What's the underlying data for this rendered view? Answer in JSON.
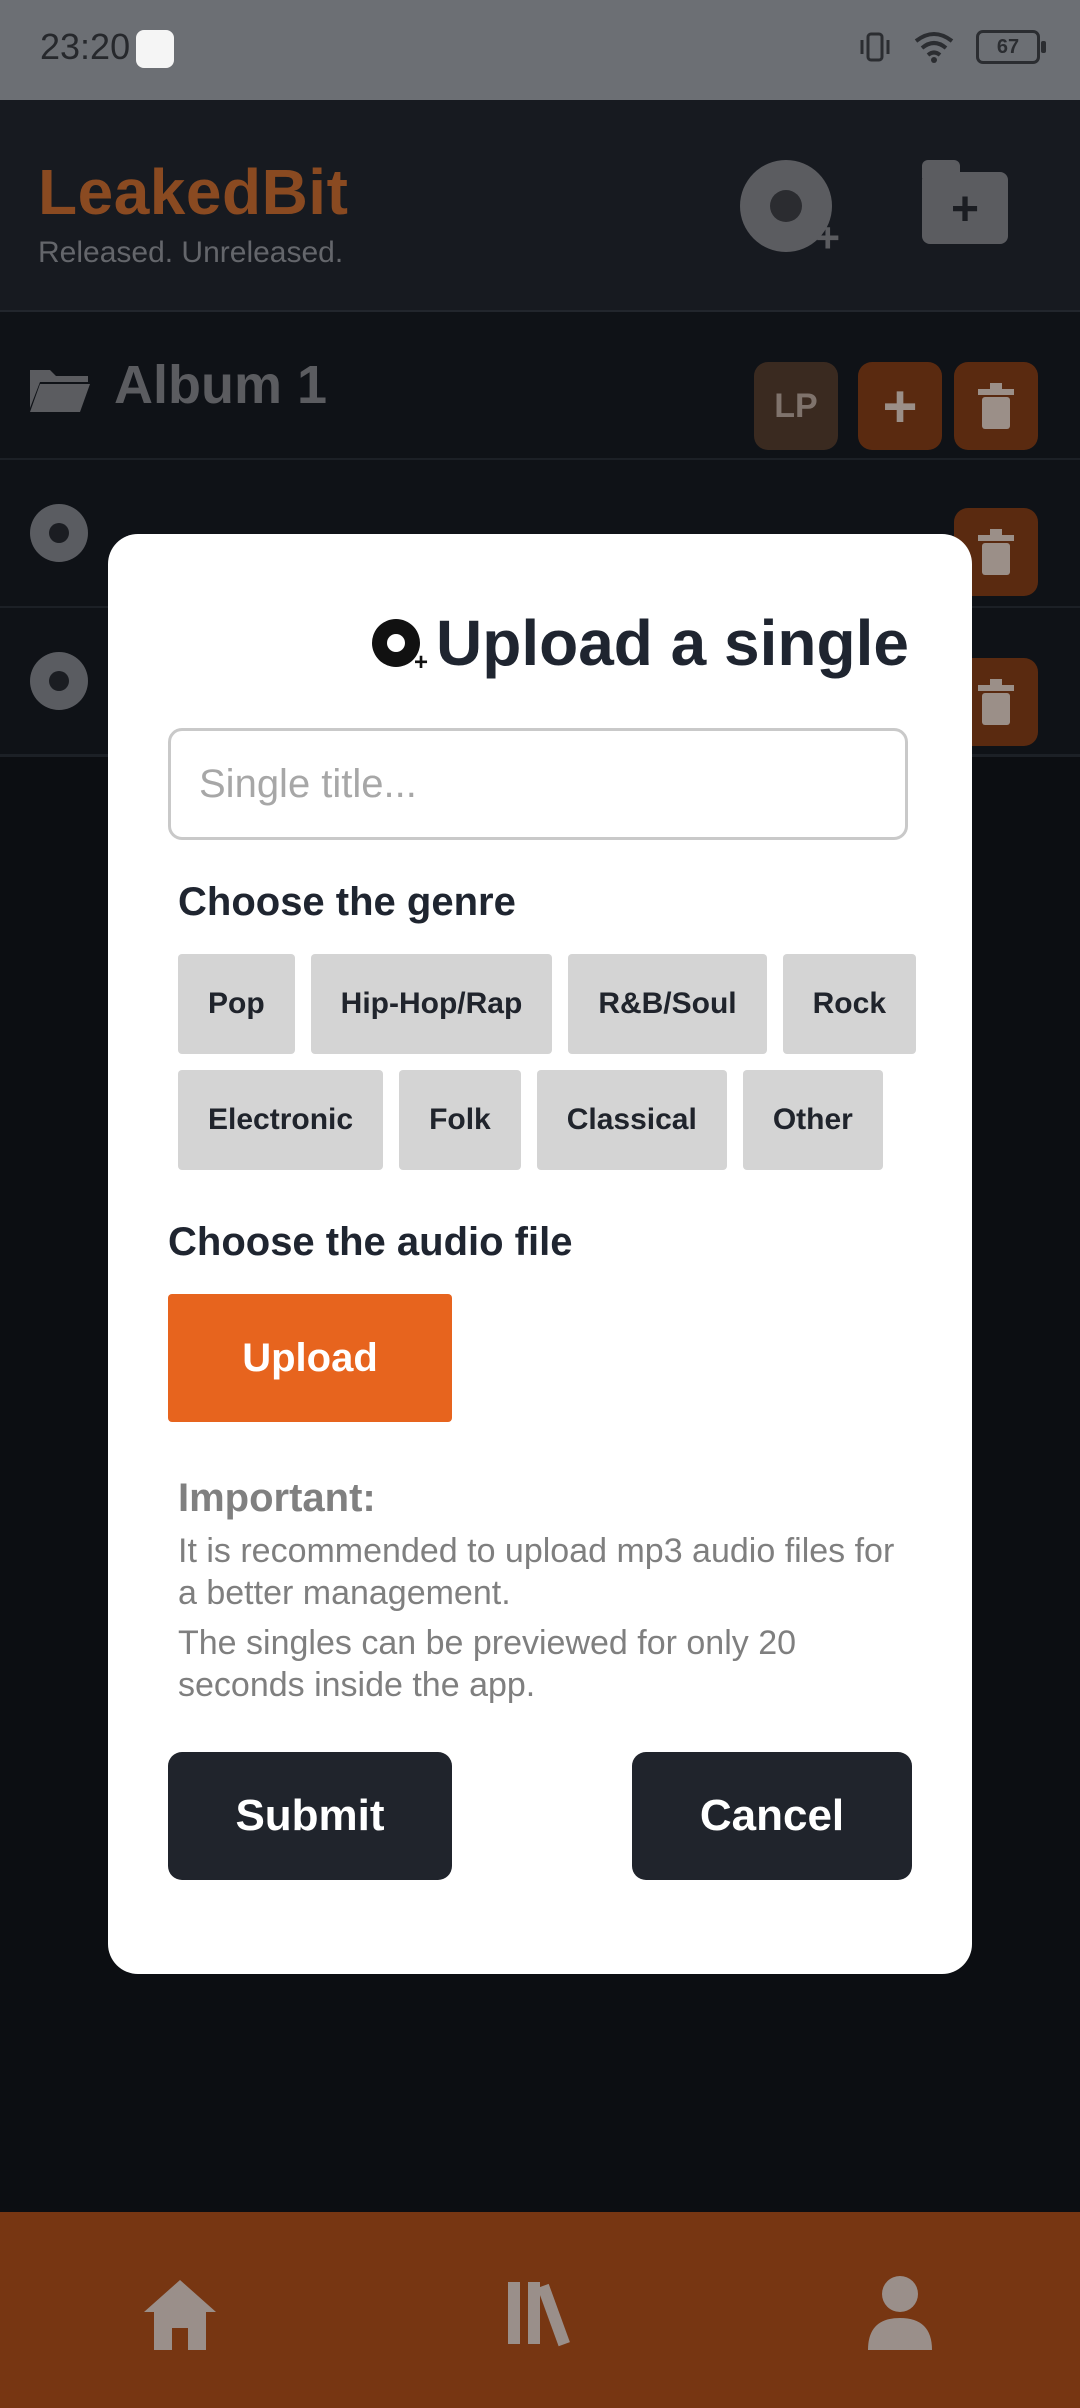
{
  "status_bar": {
    "time": "23:20",
    "battery": "67"
  },
  "app": {
    "brand": "LeakedBit",
    "tagline": "Released. Unreleased."
  },
  "list": {
    "album_title": "Album 1",
    "lp_label": "LP",
    "plus_label": "+"
  },
  "modal": {
    "title": "Upload a single",
    "title_input_placeholder": "Single title...",
    "genre_label": "Choose the genre",
    "genres": [
      "Pop",
      "Hip-Hop/Rap",
      "R&B/Soul",
      "Rock",
      "Electronic",
      "Folk",
      "Classical",
      "Other"
    ],
    "audio_label": "Choose the audio file",
    "upload_label": "Upload",
    "important_label": "Important:",
    "note1": "It is recommended to upload mp3 audio files for a better management.",
    "note2": "The singles can be previewed for only 20 seconds inside the app.",
    "submit_label": "Submit",
    "cancel_label": "Cancel"
  },
  "colors": {
    "accent": "#e7641e",
    "dark": "#20242c",
    "nav_bg": "#773612"
  },
  "icons": [
    "vibrate-icon",
    "wifi-icon",
    "battery-icon",
    "disc-add-icon",
    "folder-add-icon",
    "folder-icon",
    "trash-icon",
    "home-icon",
    "library-icon",
    "profile-icon"
  ]
}
